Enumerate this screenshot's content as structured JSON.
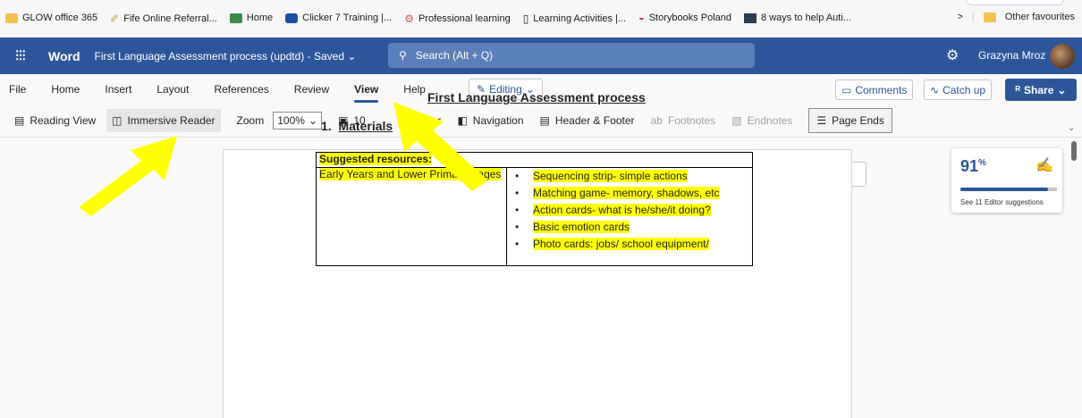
{
  "bookmarks": [
    {
      "label": "GLOW office 365",
      "icon": "folder-icon"
    },
    {
      "label": "Fife Online Referral...",
      "icon": "leaf-icon"
    },
    {
      "label": "Home",
      "icon": "app-icon"
    },
    {
      "label": "Clicker 7 Training |...",
      "icon": "app-icon"
    },
    {
      "label": "Professional learning",
      "icon": "app-icon"
    },
    {
      "label": "Learning Activities |...",
      "icon": "page-icon"
    },
    {
      "label": "Storybooks Poland",
      "icon": "app-icon"
    },
    {
      "label": "8 ways to help Auti...",
      "icon": "grid-icon"
    }
  ],
  "bookmarks_right": {
    "chevron": ">",
    "other": "Other favourites"
  },
  "app": {
    "name": "Word",
    "doc_title": "First Language Assessment process (updtd)  -  Saved",
    "search_placeholder": "Search (Alt + Q)",
    "user": "Grazyna Mroz"
  },
  "tabs": [
    "File",
    "Home",
    "Insert",
    "Layout",
    "References",
    "Review",
    "View",
    "Help"
  ],
  "active_tab": "View",
  "tab_actions": {
    "editing": "Editing",
    "comments": "Comments",
    "catch_up": "Catch up",
    "share": "Share"
  },
  "ribbon": {
    "reading_view": "Reading View",
    "immersive_reader": "Immersive Reader",
    "zoom": "Zoom",
    "zoom_value": "100%",
    "fit": "10",
    "ruler": "Ruler",
    "navigation": "Navigation",
    "header_footer": "Header & Footer",
    "footnotes": "Footnotes",
    "endnotes": "Endnotes",
    "page_ends": "Page Ends"
  },
  "document": {
    "title": "First Language Assessment process",
    "section_number": "1.",
    "section_title": "Materials",
    "table_header": "Suggested resources:",
    "row_label": "Early Years and Lower Primary stages",
    "items": [
      "Sequencing strip- simple actions",
      "Matching game- memory, shadows, etc",
      "Action cards- what is he/she/it doing?",
      "Basic emotion cards",
      "Photo cards: jobs/ school equipment/"
    ]
  },
  "editor": {
    "score": "91",
    "suffix": "%",
    "progress": 0.91,
    "link": "See 11 Editor suggestions"
  },
  "colors": {
    "word_blue": "#2b579a",
    "highlight": "#ffff00",
    "arrow": "#ffff00"
  }
}
